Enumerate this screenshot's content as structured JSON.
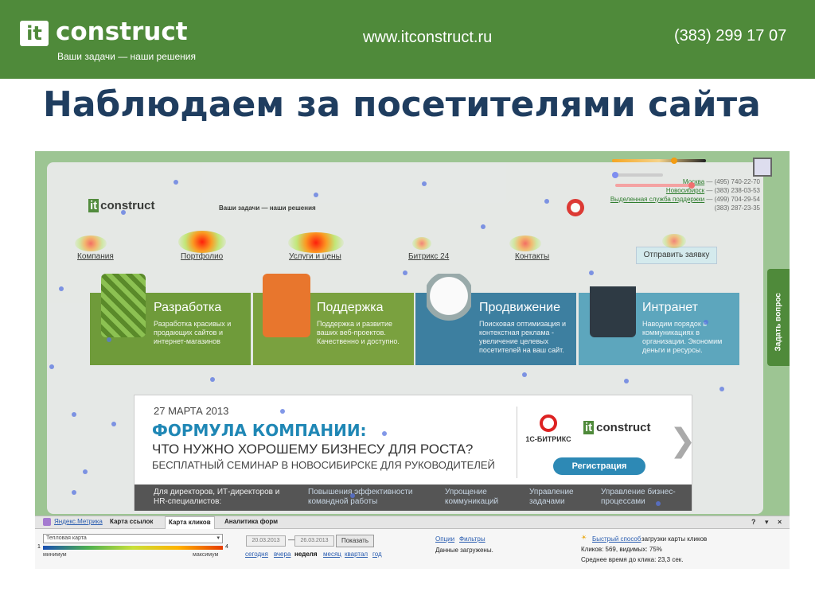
{
  "header": {
    "logo_mark": "it",
    "logo_word": "construct",
    "tagline": "Ваши задачи — наши решения",
    "url": "www.itconstruct.ru",
    "phone": "(383) 299 17 07",
    "bg_color": "#4f8a3a"
  },
  "slide_title": "Наблюдаем за посетителями сайта",
  "site": {
    "logo_mark": "it",
    "logo_word": "construct",
    "tagline": "Ваши задачи — наши решения",
    "contacts": [
      {
        "city": "Москва",
        "phone": " — (495) 740-22-70"
      },
      {
        "city": "Новосибирск",
        "phone": " — (383) 238-03-53"
      },
      {
        "city": "Выделенная служба поддержки",
        "phone": " — (499) 704-29-54"
      },
      {
        "city": "",
        "phone": "(383) 287-23-35"
      }
    ],
    "menu": [
      "Компания",
      "Портфолио",
      "Услуги и цены",
      "Битрикс 24",
      "Контакты"
    ],
    "send_request": "Отправить заявку",
    "tiles": [
      {
        "title": "Разработка",
        "desc": "Разработка красивых и продающих сайтов и интернет-магазинов",
        "color": "#6f9b3a"
      },
      {
        "title": "Поддержка",
        "desc": "Поддержка и развитие ваших веб-проектов. Качественно и доступно.",
        "color": "#7aa13f"
      },
      {
        "title": "Продвижение",
        "desc": "Поисковая оптимизация и контекстная реклама - увеличение целевых посетителей на ваш сайт.",
        "color": "#3d7fa0"
      },
      {
        "title": "Интранет",
        "desc": "Наводим порядок в коммуникациях в организации. Экономим деньги и ресурсы.",
        "color": "#5da6bd"
      }
    ],
    "banner": {
      "date": "27 МАРТА 2013",
      "headline": "ФОРМУЛА КОМПАНИИ:",
      "subheadline": "ЧТО НУЖНО ХОРОШЕМУ БИЗНЕСУ ДЛЯ РОСТА?",
      "line3": "БЕСПЛАТНЫЙ СЕМИНАР В НОВОСИБИРСКЕ ДЛЯ РУКОВОДИТЕЛЕЙ",
      "bitrix": "1С-БИТРИКС",
      "register": "Регистрация",
      "arrow": "❯",
      "footer": [
        "Для директоров, ИТ-директоров и HR-специалистов:",
        "Повышения эффективности командной работы",
        "Упрощение коммуникаций",
        "Управление задачами",
        "Управление бизнес-процессами"
      ]
    },
    "side_tab": "Задать вопрос"
  },
  "metrika": {
    "brand": "Яндекс.Метрика",
    "tabs": [
      "Карта ссылок",
      "Карта кликов",
      "Аналитика форм"
    ],
    "active_tab": "Карта кликов",
    "controls": [
      "?",
      "▾",
      "×"
    ],
    "select_value": "Тепловая карта",
    "range_min": "минимум",
    "range_max": "максимум",
    "range_min_num": "1",
    "range_max_num": "4",
    "date_from": "20.03.2013",
    "date_sep": "—",
    "date_to": "26.03.2013",
    "show_button": "Показать",
    "periods": [
      "сегодня",
      "вчера",
      "неделя",
      "месяц",
      "квартал",
      "год"
    ],
    "active_period": "неделя",
    "options": "Опции",
    "filters": "Фильтры",
    "loaded": "Данные загружены.",
    "fast_link": "Быстрый способ",
    "fast_text": " загрузки карты кликов",
    "clicks": "Кликов: 569, видимых: 75%",
    "avg_time": "Среднее время до клика: 23,3 сек."
  }
}
